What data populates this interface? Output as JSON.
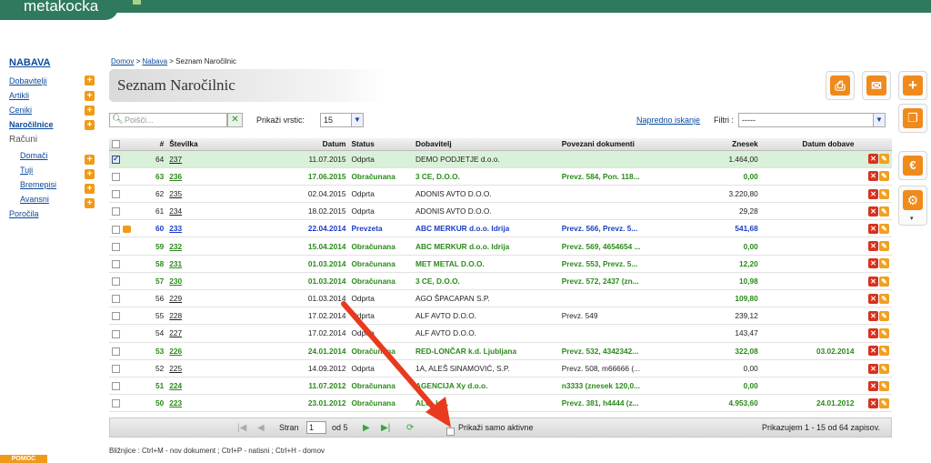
{
  "app": {
    "logo": "metakocka"
  },
  "sidebar": {
    "section": "NABAVA",
    "items": [
      {
        "label": "Dobavitelji",
        "plus": true
      },
      {
        "label": "Artikli",
        "plus": true
      },
      {
        "label": "Ceniki",
        "plus": true
      },
      {
        "label": "Naročilnice",
        "plus": true,
        "active": true
      }
    ],
    "group": "Računi",
    "group_items": [
      {
        "label": "Domači",
        "plus": true
      },
      {
        "label": "Tuji",
        "plus": true
      },
      {
        "label": "Bremepisi",
        "plus": true
      },
      {
        "label": "Avansni",
        "plus": true
      }
    ],
    "footer_item": "Poročila",
    "help_label": "POMOČ"
  },
  "breadcrumb": {
    "home": "Domov",
    "sep1": " > ",
    "section": "Nabava",
    "sep2": " > ",
    "current": "Seznam Naročilnic"
  },
  "page_title": "Seznam Naročilnic",
  "toolbar": {
    "search_placeholder": "Poišči...",
    "rows_label": "Prikaži vrstic:",
    "rows_value": "15",
    "advanced_search": "Napredno iskanje",
    "filters_label": "Filtri :",
    "filters_value": "-----"
  },
  "table": {
    "headers": [
      "",
      "#",
      "Številka",
      "Datum",
      "Status",
      "Dobavitelj",
      "Povezani dokumenti",
      "Znesek",
      "Datum dobave",
      ""
    ],
    "rows": [
      {
        "idx": "64",
        "num": "237",
        "date": "11.07.2015",
        "status": "Odprta",
        "supplier": "DEMO PODJETJE d.o.o.",
        "docs": "",
        "amount": "1.464,00",
        "delivery": "",
        "style": "hl",
        "checked": true
      },
      {
        "idx": "63",
        "num": "236",
        "date": "17.06.2015",
        "status": "Obračunana",
        "supplier": "3 CE, D.O.O.",
        "docs": "Prevz. 584, Pon. 118...",
        "amount": "0,00",
        "delivery": "",
        "style": "green"
      },
      {
        "idx": "62",
        "num": "235",
        "date": "02.04.2015",
        "status": "Odprta",
        "supplier": "ADONIS AVTO D.O.O.",
        "docs": "",
        "amount": "3.220,80",
        "delivery": "",
        "style": ""
      },
      {
        "idx": "61",
        "num": "234",
        "date": "18.02.2015",
        "status": "Odprta",
        "supplier": "ADONIS AVTO D.O.O.",
        "docs": "",
        "amount": "29,28",
        "delivery": "",
        "style": ""
      },
      {
        "idx": "60",
        "num": "233",
        "date": "22.04.2014",
        "status": "Prevzeta",
        "supplier": "ABC MERKUR d.o.o. Idrija",
        "docs": "Prevz. 566, Prevz. 5...",
        "amount": "541,68",
        "delivery": "",
        "style": "blue",
        "printer": true
      },
      {
        "idx": "59",
        "num": "232",
        "date": "15.04.2014",
        "status": "Obračunana",
        "supplier": "ABC MERKUR d.o.o. Idrija",
        "docs": "Prevz. 569, 4654654 ...",
        "amount": "0,00",
        "delivery": "",
        "style": "green"
      },
      {
        "idx": "58",
        "num": "231",
        "date": "01.03.2014",
        "status": "Obračunana",
        "supplier": "MET METAL D.O.O.",
        "docs": "Prevz. 553, Prevz. 5...",
        "amount": "12,20",
        "delivery": "",
        "style": "green"
      },
      {
        "idx": "57",
        "num": "230",
        "date": "01.03.2014",
        "status": "Obračunana",
        "supplier": "3 CE, D.O.O.",
        "docs": "Prevz. 572, 2437 (zn...",
        "amount": "10,98",
        "delivery": "",
        "style": "green"
      },
      {
        "idx": "56",
        "num": "229",
        "date": "01.03.2014",
        "status": "Odprta",
        "supplier": "AGO ŠPACAPAN S.P.",
        "docs": "",
        "amount": "109,80",
        "delivery": "",
        "style": "",
        "bold_amount": true
      },
      {
        "idx": "55",
        "num": "228",
        "date": "17.02.2014",
        "status": "Odprta",
        "supplier": "ALF AVTO D.O.O.",
        "docs": "Prevz. 549",
        "amount": "239,12",
        "delivery": "",
        "style": ""
      },
      {
        "idx": "54",
        "num": "227",
        "date": "17.02.2014",
        "status": "Odprta",
        "supplier": "ALF AVTO D.O.O.",
        "docs": "",
        "amount": "143,47",
        "delivery": "",
        "style": ""
      },
      {
        "idx": "53",
        "num": "226",
        "date": "24.01.2014",
        "status": "Obračunana",
        "supplier": "RED-LONČAR k.d. Ljubljana",
        "docs": "Prevz. 532, 4342342...",
        "amount": "322,08",
        "delivery": "03.02.2014",
        "style": "green"
      },
      {
        "idx": "52",
        "num": "225",
        "date": "14.09.2012",
        "status": "Odprta",
        "supplier": "1A, ALEŠ SINAMOVIĆ, S.P.",
        "docs": "Prevz. 508, m66666 (...",
        "amount": "0,00",
        "delivery": "",
        "style": ""
      },
      {
        "idx": "51",
        "num": "224",
        "date": "11.07.2012",
        "status": "Obračunana",
        "supplier": "AGENCIJA Xy d.o.o.",
        "docs": "n3333 (znesek 120,0...",
        "amount": "0,00",
        "delivery": "",
        "style": "green"
      },
      {
        "idx": "50",
        "num": "223",
        "date": "23.01.2012",
        "status": "Obračunana",
        "supplier": "ALO, k.d.",
        "docs": "Prevz. 381, h4444 (z...",
        "amount": "4.953,60",
        "delivery": "24.01.2012",
        "style": "green"
      }
    ]
  },
  "pager": {
    "page_label": "Stran",
    "page_value": "1",
    "of_label": "od 5",
    "active_only": "Prikaži samo aktivne",
    "summary": "Prikazujem 1 - 15 od 64 zapisov."
  },
  "shortcuts": "Bližnjice : Ctrl+M - nov dokument ;  Ctrl+P - natisni ;  Ctrl+H - domov",
  "colors": {
    "brand": "#2f7a5c",
    "accent": "#f08a1c",
    "link": "#0b4a99",
    "green_row": "#2a8a1a",
    "blue_row": "#1a3cc4"
  }
}
